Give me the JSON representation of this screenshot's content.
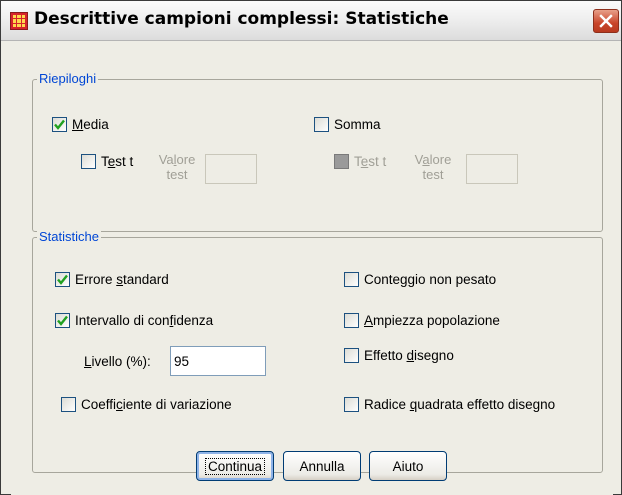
{
  "window": {
    "title": "Descrittive campioni complessi: Statistiche",
    "icons": {
      "app": "spss-grid-icon",
      "close": "close-icon"
    }
  },
  "riepiloghi": {
    "legend": "Riepiloghi",
    "media": {
      "label_pre": "",
      "label_u": "M",
      "label_post": "edia",
      "checked": true
    },
    "media_test": {
      "label_pre": "T",
      "label_u": "e",
      "label_post": "st t",
      "checked": false,
      "enabled": true
    },
    "media_valore": {
      "line1_pre": "Va",
      "line1_u": "l",
      "line1_post": "ore",
      "line2": "test",
      "value": ""
    },
    "somma": {
      "label": "Somma",
      "checked": false
    },
    "somma_test": {
      "label_pre": "T",
      "label_u": "e",
      "label_post": "st t",
      "checked": false,
      "enabled": false
    },
    "somma_valore": {
      "line1_pre": "V",
      "line1_u": "a",
      "line1_post": "lore",
      "line2": "test",
      "value": ""
    }
  },
  "statistiche": {
    "legend": "Statistiche",
    "errore_standard": {
      "label_pre": "Errore ",
      "label_u": "s",
      "label_post": "tandard",
      "checked": true
    },
    "intervallo": {
      "label_pre": "Intervallo di con",
      "label_u": "f",
      "label_post": "idenza",
      "checked": true
    },
    "livello": {
      "label_pre": "",
      "label_u": "L",
      "label_post": "ivello (%):",
      "value": "95"
    },
    "coefficiente": {
      "label_pre": "Coeffi",
      "label_u": "c",
      "label_post": "iente di variazione",
      "checked": false
    },
    "conteggio": {
      "label_pre": "Conte",
      "label_u": "g",
      "label_post": "gio non pesato",
      "checked": false
    },
    "ampiezza": {
      "label_pre": "",
      "label_u": "A",
      "label_post": "mpiezza popolazione",
      "checked": false
    },
    "effetto": {
      "label_pre": "Effetto ",
      "label_u": "d",
      "label_post": "isegno",
      "checked": false
    },
    "radice": {
      "label_pre": "Radice ",
      "label_u": "q",
      "label_post": "uadrata effetto disegno",
      "checked": false
    }
  },
  "buttons": {
    "continua": "Continua",
    "annulla": "Annulla",
    "aiuto": "Aiuto"
  }
}
